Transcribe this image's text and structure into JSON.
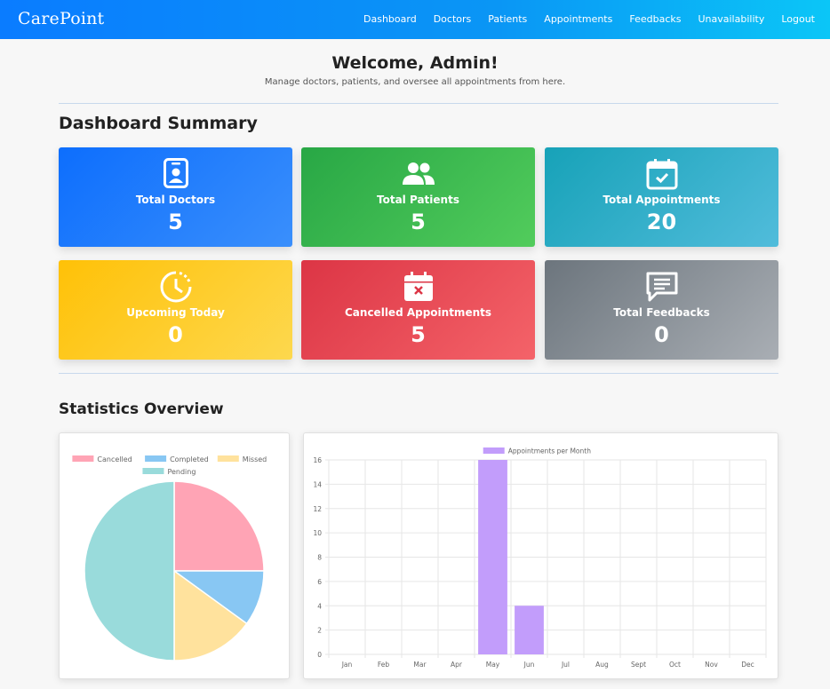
{
  "navbar": {
    "brand": "CarePoint",
    "links": [
      "Dashboard",
      "Doctors",
      "Patients",
      "Appointments",
      "Feedbacks",
      "Unavailability",
      "Logout"
    ]
  },
  "welcome": {
    "title": "Welcome, Admin!",
    "subtitle": "Manage doctors, patients, and oversee all appointments from here."
  },
  "summary": {
    "title": "Dashboard Summary",
    "cards": [
      {
        "label": "Total Doctors",
        "value": "5",
        "icon": "id-badge-icon"
      },
      {
        "label": "Total Patients",
        "value": "5",
        "icon": "users-icon"
      },
      {
        "label": "Total Appointments",
        "value": "20",
        "icon": "calendar-check-icon"
      },
      {
        "label": "Upcoming Today",
        "value": "0",
        "icon": "clock-icon"
      },
      {
        "label": "Cancelled Appointments",
        "value": "5",
        "icon": "calendar-x-icon"
      },
      {
        "label": "Total Feedbacks",
        "value": "0",
        "icon": "message-icon"
      }
    ]
  },
  "statistics": {
    "title": "Statistics Overview"
  },
  "chart_data": [
    {
      "type": "pie",
      "labels": [
        "Cancelled",
        "Completed",
        "Missed",
        "Pending"
      ],
      "values": [
        5,
        2,
        3,
        10
      ],
      "colors": [
        "#ffa4b5",
        "#88c7f3",
        "#ffe29d",
        "#99dbdb"
      ],
      "legend": "top"
    },
    {
      "type": "bar",
      "categories": [
        "Jan",
        "Feb",
        "Mar",
        "Apr",
        "May",
        "Jun",
        "Jul",
        "Aug",
        "Sept",
        "Oct",
        "Nov",
        "Dec"
      ],
      "series": [
        {
          "name": "Appointments per Month",
          "values": [
            0,
            0,
            0,
            0,
            16,
            4,
            0,
            0,
            0,
            0,
            0,
            0
          ]
        }
      ],
      "y_ticks": [
        "0",
        "2",
        "4",
        "6",
        "8",
        "10",
        "12",
        "14",
        "16"
      ],
      "ylim": [
        0,
        16
      ],
      "color": "#c29dfb",
      "grid": true,
      "legend": "top"
    }
  ]
}
